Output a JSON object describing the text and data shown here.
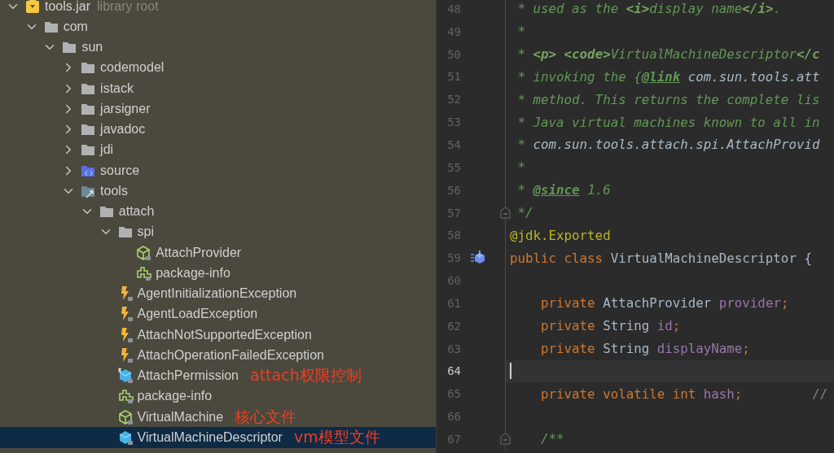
{
  "project_tree": {
    "items": [
      {
        "name": "tools.jar",
        "suffix": "library root",
        "kind": "jar",
        "expanded": true,
        "selected": false,
        "children": [
          {
            "name": "com",
            "kind": "folder",
            "expanded": true,
            "selected": false,
            "children": [
              {
                "name": "sun",
                "kind": "folder",
                "expanded": true,
                "selected": false,
                "children": [
                  {
                    "name": "codemodel",
                    "kind": "folder",
                    "expanded": false,
                    "selected": false
                  },
                  {
                    "name": "istack",
                    "kind": "folder",
                    "expanded": false,
                    "selected": false
                  },
                  {
                    "name": "jarsigner",
                    "kind": "folder",
                    "expanded": false,
                    "selected": false
                  },
                  {
                    "name": "javadoc",
                    "kind": "folder",
                    "expanded": false,
                    "selected": false
                  },
                  {
                    "name": "jdi",
                    "kind": "folder",
                    "expanded": false,
                    "selected": false
                  },
                  {
                    "name": "source",
                    "kind": "source-folder",
                    "expanded": false,
                    "selected": false
                  },
                  {
                    "name": "tools",
                    "kind": "tools-folder",
                    "expanded": true,
                    "selected": false,
                    "children": [
                      {
                        "name": "attach",
                        "kind": "folder",
                        "expanded": true,
                        "selected": false,
                        "children": [
                          {
                            "name": "spi",
                            "kind": "folder",
                            "expanded": true,
                            "selected": false,
                            "children": [
                              {
                                "name": "AttachProvider",
                                "kind": "interface",
                                "selected": false
                              },
                              {
                                "name": "package-info",
                                "kind": "package-info",
                                "selected": false
                              }
                            ]
                          },
                          {
                            "name": "AgentInitializationException",
                            "kind": "exception",
                            "selected": false
                          },
                          {
                            "name": "AgentLoadException",
                            "kind": "exception",
                            "selected": false
                          },
                          {
                            "name": "AttachNotSupportedException",
                            "kind": "exception",
                            "selected": false
                          },
                          {
                            "name": "AttachOperationFailedException",
                            "kind": "exception",
                            "selected": false
                          },
                          {
                            "name": "AttachPermission",
                            "kind": "permission",
                            "selected": false,
                            "annotation": "attach权限控制"
                          },
                          {
                            "name": "package-info",
                            "kind": "package-info",
                            "selected": false
                          },
                          {
                            "name": "VirtualMachine",
                            "kind": "interface",
                            "selected": false,
                            "annotation": "核心文件"
                          },
                          {
                            "name": "VirtualMachineDescriptor",
                            "kind": "class",
                            "selected": true,
                            "annotation": "vm模型文件"
                          }
                        ]
                      }
                    ]
                  }
                ]
              }
            ]
          }
        ]
      }
    ]
  },
  "editor": {
    "lines": [
      {
        "number": "48",
        "current": false,
        "fold": false,
        "gutter_icon": false,
        "tokens": [
          {
            "kind": "comment",
            "text": " * used as the "
          },
          {
            "kind": "html",
            "text": "<i>"
          },
          {
            "kind": "comment",
            "text": "display name"
          },
          {
            "kind": "html",
            "text": "</i>"
          },
          {
            "kind": "comment",
            "text": "."
          }
        ]
      },
      {
        "number": "49",
        "current": false,
        "fold": false,
        "gutter_icon": false,
        "tokens": [
          {
            "kind": "comment",
            "text": " *"
          }
        ]
      },
      {
        "number": "50",
        "current": false,
        "fold": false,
        "gutter_icon": false,
        "tokens": [
          {
            "kind": "comment",
            "text": " * "
          },
          {
            "kind": "html",
            "text": "<p> <code>"
          },
          {
            "kind": "comment",
            "text": "VirtualMachineDescriptor"
          },
          {
            "kind": "html",
            "text": "</c"
          }
        ]
      },
      {
        "number": "51",
        "current": false,
        "fold": false,
        "gutter_icon": false,
        "tokens": [
          {
            "kind": "comment",
            "text": " * invoking the {"
          },
          {
            "kind": "doc-tag",
            "text": "@link"
          },
          {
            "kind": "ref",
            "text": " com.sun.tools.att"
          }
        ]
      },
      {
        "number": "52",
        "current": false,
        "fold": false,
        "gutter_icon": false,
        "tokens": [
          {
            "kind": "comment",
            "text": " * method. This returns the complete lis"
          }
        ]
      },
      {
        "number": "53",
        "current": false,
        "fold": false,
        "gutter_icon": false,
        "tokens": [
          {
            "kind": "comment",
            "text": " * Java virtual machines known to all in"
          }
        ]
      },
      {
        "number": "54",
        "current": false,
        "fold": false,
        "gutter_icon": false,
        "tokens": [
          {
            "kind": "comment",
            "text": " * "
          },
          {
            "kind": "ref",
            "text": "com.sun.tools.attach.spi.AttachProvid"
          }
        ]
      },
      {
        "number": "55",
        "current": false,
        "fold": false,
        "gutter_icon": false,
        "tokens": [
          {
            "kind": "comment",
            "text": " *"
          }
        ]
      },
      {
        "number": "56",
        "current": false,
        "fold": false,
        "gutter_icon": false,
        "tokens": [
          {
            "kind": "comment",
            "text": " * "
          },
          {
            "kind": "doc-tag",
            "text": "@since"
          },
          {
            "kind": "comment",
            "text": " 1.6"
          }
        ]
      },
      {
        "number": "57",
        "current": false,
        "fold": true,
        "gutter_icon": false,
        "tokens": [
          {
            "kind": "comment",
            "text": " */"
          }
        ]
      },
      {
        "number": "58",
        "current": false,
        "fold": false,
        "gutter_icon": false,
        "tokens": [
          {
            "kind": "annotation",
            "text": "@jdk.Exported"
          }
        ]
      },
      {
        "number": "59",
        "current": false,
        "fold": false,
        "gutter_icon": true,
        "tokens": [
          {
            "kind": "keyword",
            "text": "public class "
          },
          {
            "kind": "plain",
            "text": "VirtualMachineDescriptor {"
          }
        ]
      },
      {
        "number": "60",
        "current": false,
        "fold": false,
        "gutter_icon": false
      },
      {
        "number": "61",
        "current": false,
        "fold": false,
        "gutter_icon": false,
        "tokens": [
          {
            "kind": "keyword",
            "text": "    private "
          },
          {
            "kind": "plain",
            "text": "AttachProvider "
          },
          {
            "kind": "field",
            "text": "provider"
          },
          {
            "kind": "keyword",
            "text": ";"
          }
        ]
      },
      {
        "number": "62",
        "current": false,
        "fold": false,
        "gutter_icon": false,
        "tokens": [
          {
            "kind": "keyword",
            "text": "    private "
          },
          {
            "kind": "plain",
            "text": "String "
          },
          {
            "kind": "field",
            "text": "id"
          },
          {
            "kind": "keyword",
            "text": ";"
          }
        ]
      },
      {
        "number": "63",
        "current": false,
        "fold": false,
        "gutter_icon": false,
        "tokens": [
          {
            "kind": "keyword",
            "text": "    private "
          },
          {
            "kind": "plain",
            "text": "String "
          },
          {
            "kind": "field",
            "text": "displayName"
          },
          {
            "kind": "keyword",
            "text": ";"
          }
        ]
      },
      {
        "number": "64",
        "current": true,
        "fold": false,
        "gutter_icon": false
      },
      {
        "number": "65",
        "current": false,
        "fold": false,
        "gutter_icon": false,
        "tokens": [
          {
            "kind": "keyword",
            "text": "    private volatile int "
          },
          {
            "kind": "field",
            "text": "hash"
          },
          {
            "kind": "keyword",
            "text": ";"
          },
          {
            "kind": "line-comment",
            "text": "         //"
          }
        ]
      },
      {
        "number": "66",
        "current": false,
        "fold": false,
        "gutter_icon": false
      },
      {
        "number": "67",
        "current": false,
        "fold": true,
        "gutter_icon": false,
        "tokens": [
          {
            "kind": "comment",
            "text": "    /**"
          }
        ]
      }
    ]
  }
}
